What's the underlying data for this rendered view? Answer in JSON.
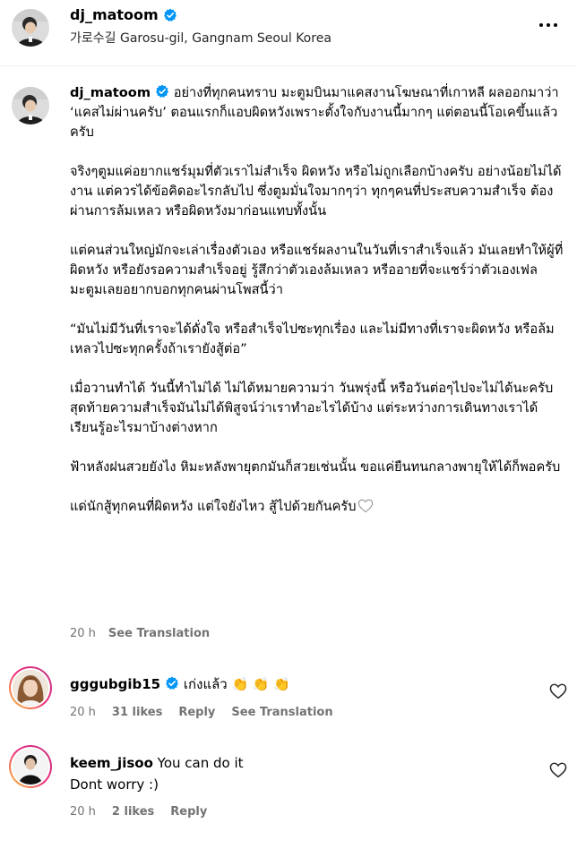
{
  "header": {
    "username": "dj_matoom",
    "location": "가로수길 Garosu-gil, Gangnam Seoul Korea"
  },
  "caption": {
    "username": "dj_matoom",
    "paragraphs": [
      "อย่างที่ทุกคนทราบ มะตูมบินมาแคสงานโฆษณาที่เกาหลี ผลออกมาว่า ‘แคสไม่ผ่านครับ’ ตอนแรกก็แอบผิดหวังเพราะตั้งใจกับงานนี้มากๆ แต่ตอนนี้โอเคขึ้นแล้วครับ",
      "จริงๆตูมแค่อยากแชร์มุมที่ตัวเราไม่สำเร็จ ผิดหวัง หรือไม่ถูกเลือกบ้างครับ อย่างน้อยไม่ได้งาน แต่ควรได้ข้อคิดอะไรกลับไป ซึ่งตูมมั่นใจมากๆว่า ทุกๆคนที่ประสบความสำเร็จ ต้องผ่านการล้มเหลว หรือผิดหวังมาก่อนแทบทั้งนั้น",
      "แต่คนส่วนใหญ่มักจะเล่าเรื่องตัวเอง หรือแชร์ผลงานในวันที่เราสำเร็จแล้ว มันเลยทำให้ผู้ที่ผิดหวัง หรือยังรอความสำเร็จอยู่ รู้สึกว่าตัวเองล้มเหลว หรืออายที่จะแชร์ว่าตัวเองเฟล มะตูมเลยอยากบอกทุกคนผ่านโพสนี้ว่า",
      "“มันไม่มีวันที่เราจะได้ดั่งใจ หรือสำเร็จไปซะทุกเรื่อง และไม่มีทางที่เราจะผิดหวัง หรือล้มเหลวไปซะทุกครั้งถ้าเรายังสู้ต่อ”",
      "เมื่อวานทำได้ วันนี้ทำไม่ได้ ไม่ได้หมายความว่า วันพรุ่งนี้ หรือวันต่อๆไปจะไม่ได้นะครับ",
      "สุดท้ายความสำเร็จมันไม่ได้พิสูจน์ว่าเราทำอะไรได้บ้าง แต่ระหว่างการเดินทางเราได้เรียนรู้อะไรมาบ้างต่างหาก",
      "ฟ้าหลังฝนสวยยังไง หิมะหลังพายุตกมันก็สวยเช่นนั้น ขอแค่ยืนทนกลางพายุให้ได้ก็พอครับ",
      "แด่นักสู้ทุกคนที่ผิดหวัง แต่ใจยังไหว สู้ไปด้วยกันครับ"
    ],
    "time": "20 h",
    "see_translation": "See Translation"
  },
  "comments": [
    {
      "username": "gggubgib15",
      "text": "เก่งแล้ว 👏 👏 👏",
      "time": "20 h",
      "likes": "31 likes",
      "reply": "Reply",
      "see_translation": "See Translation"
    },
    {
      "username": "keem_jisoo",
      "text_line1": "You can do it",
      "text_line2": "Dont worry :)",
      "time": "20 h",
      "likes": "2 likes",
      "reply": "Reply"
    }
  ],
  "icons": {
    "verified": "verified-badge-icon",
    "more": "more-horizontal-icon",
    "heart": "heart-outline-icon"
  },
  "colors": {
    "verified": "#0095f6",
    "meta_text": "#737373",
    "story_ring_start": "#f9ce34",
    "story_ring_end": "#c13584"
  }
}
